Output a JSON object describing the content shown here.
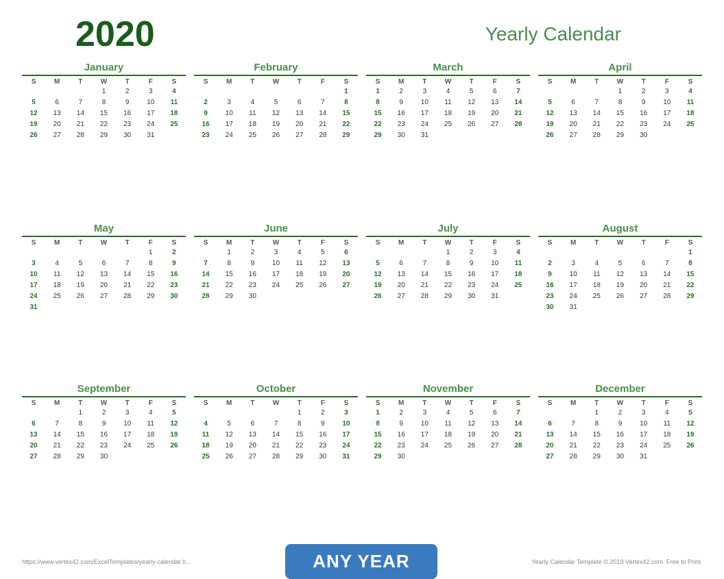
{
  "header": {
    "year": "2020",
    "title": "Yearly Calendar"
  },
  "months": [
    {
      "name": "January",
      "days": [
        {
          "week": [
            null,
            null,
            null,
            1,
            2,
            3,
            4
          ]
        },
        {
          "week": [
            5,
            6,
            7,
            8,
            9,
            10,
            11
          ]
        },
        {
          "week": [
            12,
            13,
            14,
            15,
            16,
            17,
            18
          ]
        },
        {
          "week": [
            19,
            20,
            21,
            22,
            23,
            24,
            25
          ]
        },
        {
          "week": [
            26,
            27,
            28,
            29,
            30,
            31,
            null
          ]
        }
      ]
    },
    {
      "name": "February",
      "days": [
        {
          "week": [
            null,
            null,
            null,
            null,
            null,
            null,
            1
          ]
        },
        {
          "week": [
            2,
            3,
            4,
            5,
            6,
            7,
            8
          ]
        },
        {
          "week": [
            9,
            10,
            11,
            12,
            13,
            14,
            15
          ]
        },
        {
          "week": [
            16,
            17,
            18,
            19,
            20,
            21,
            22
          ]
        },
        {
          "week": [
            23,
            24,
            25,
            26,
            27,
            28,
            29
          ]
        }
      ]
    },
    {
      "name": "March",
      "days": [
        {
          "week": [
            1,
            2,
            3,
            4,
            5,
            6,
            7
          ]
        },
        {
          "week": [
            8,
            9,
            10,
            11,
            12,
            13,
            14
          ]
        },
        {
          "week": [
            15,
            16,
            17,
            18,
            19,
            20,
            21
          ]
        },
        {
          "week": [
            22,
            23,
            24,
            25,
            26,
            27,
            28
          ]
        },
        {
          "week": [
            29,
            30,
            31,
            null,
            null,
            null,
            null
          ]
        }
      ]
    },
    {
      "name": "April",
      "days": [
        {
          "week": [
            null,
            null,
            null,
            1,
            2,
            3,
            4
          ]
        },
        {
          "week": [
            5,
            6,
            7,
            8,
            9,
            10,
            11
          ]
        },
        {
          "week": [
            12,
            13,
            14,
            15,
            16,
            17,
            18
          ]
        },
        {
          "week": [
            19,
            20,
            21,
            22,
            23,
            24,
            25
          ]
        },
        {
          "week": [
            26,
            27,
            28,
            29,
            30,
            null,
            null
          ]
        }
      ]
    },
    {
      "name": "May",
      "days": [
        {
          "week": [
            null,
            null,
            null,
            null,
            null,
            1,
            2
          ]
        },
        {
          "week": [
            3,
            4,
            5,
            6,
            7,
            8,
            9
          ]
        },
        {
          "week": [
            10,
            11,
            12,
            13,
            14,
            15,
            16
          ]
        },
        {
          "week": [
            17,
            18,
            19,
            20,
            21,
            22,
            23
          ]
        },
        {
          "week": [
            24,
            25,
            26,
            27,
            28,
            29,
            30
          ]
        },
        {
          "week": [
            31,
            null,
            null,
            null,
            null,
            null,
            null
          ]
        }
      ]
    },
    {
      "name": "June",
      "days": [
        {
          "week": [
            null,
            1,
            2,
            3,
            4,
            5,
            6
          ]
        },
        {
          "week": [
            7,
            8,
            9,
            10,
            11,
            12,
            13
          ]
        },
        {
          "week": [
            14,
            15,
            16,
            17,
            18,
            19,
            20
          ]
        },
        {
          "week": [
            21,
            22,
            23,
            24,
            25,
            26,
            27
          ]
        },
        {
          "week": [
            28,
            29,
            30,
            null,
            null,
            null,
            null
          ]
        }
      ]
    },
    {
      "name": "July",
      "days": [
        {
          "week": [
            null,
            null,
            null,
            1,
            2,
            3,
            4
          ]
        },
        {
          "week": [
            5,
            6,
            7,
            8,
            9,
            10,
            11
          ]
        },
        {
          "week": [
            12,
            13,
            14,
            15,
            16,
            17,
            18
          ]
        },
        {
          "week": [
            19,
            20,
            21,
            22,
            23,
            24,
            25
          ]
        },
        {
          "week": [
            26,
            27,
            28,
            29,
            30,
            31,
            null
          ]
        }
      ]
    },
    {
      "name": "August",
      "days": [
        {
          "week": [
            null,
            null,
            null,
            null,
            null,
            null,
            1
          ]
        },
        {
          "week": [
            2,
            3,
            4,
            5,
            6,
            7,
            8
          ]
        },
        {
          "week": [
            9,
            10,
            11,
            12,
            13,
            14,
            15
          ]
        },
        {
          "week": [
            16,
            17,
            18,
            19,
            20,
            21,
            22
          ]
        },
        {
          "week": [
            23,
            24,
            25,
            26,
            27,
            28,
            29
          ]
        },
        {
          "week": [
            30,
            31,
            null,
            null,
            null,
            null,
            null
          ]
        }
      ]
    },
    {
      "name": "September",
      "days": [
        {
          "week": [
            null,
            null,
            1,
            2,
            3,
            4,
            5
          ]
        },
        {
          "week": [
            6,
            7,
            8,
            9,
            10,
            11,
            12
          ]
        },
        {
          "week": [
            13,
            14,
            15,
            16,
            17,
            18,
            19
          ]
        },
        {
          "week": [
            20,
            21,
            22,
            23,
            24,
            25,
            26
          ]
        },
        {
          "week": [
            27,
            28,
            29,
            30,
            null,
            null,
            null
          ]
        }
      ]
    },
    {
      "name": "October",
      "days": [
        {
          "week": [
            null,
            null,
            null,
            null,
            1,
            2,
            3
          ]
        },
        {
          "week": [
            4,
            5,
            6,
            7,
            8,
            9,
            10
          ]
        },
        {
          "week": [
            11,
            12,
            13,
            14,
            15,
            16,
            17
          ]
        },
        {
          "week": [
            18,
            19,
            20,
            21,
            22,
            23,
            24
          ]
        },
        {
          "week": [
            25,
            26,
            27,
            28,
            29,
            30,
            31
          ]
        }
      ]
    },
    {
      "name": "November",
      "days": [
        {
          "week": [
            1,
            2,
            3,
            4,
            5,
            6,
            7
          ]
        },
        {
          "week": [
            8,
            9,
            10,
            11,
            12,
            13,
            14
          ]
        },
        {
          "week": [
            15,
            16,
            17,
            18,
            19,
            20,
            21
          ]
        },
        {
          "week": [
            22,
            23,
            24,
            25,
            26,
            27,
            28
          ]
        },
        {
          "week": [
            29,
            30,
            null,
            null,
            null,
            null,
            null
          ]
        }
      ]
    },
    {
      "name": "December",
      "days": [
        {
          "week": [
            null,
            null,
            1,
            2,
            3,
            4,
            5
          ]
        },
        {
          "week": [
            6,
            7,
            8,
            9,
            10,
            11,
            12
          ]
        },
        {
          "week": [
            13,
            14,
            15,
            16,
            17,
            18,
            19
          ]
        },
        {
          "week": [
            20,
            21,
            22,
            23,
            24,
            25,
            26
          ]
        },
        {
          "week": [
            27,
            28,
            29,
            30,
            31,
            null,
            null
          ]
        }
      ]
    }
  ],
  "dayHeaders": [
    "S",
    "M",
    "T",
    "W",
    "T",
    "F",
    "S"
  ],
  "footer": {
    "left": "https://www.vertex42.com/ExcelTemplates/yearly-calendar.h...",
    "right": "Yearly Calendar Template © 2019 Vertex42.com. Free to Print.",
    "badge": "ANY YEAR"
  }
}
